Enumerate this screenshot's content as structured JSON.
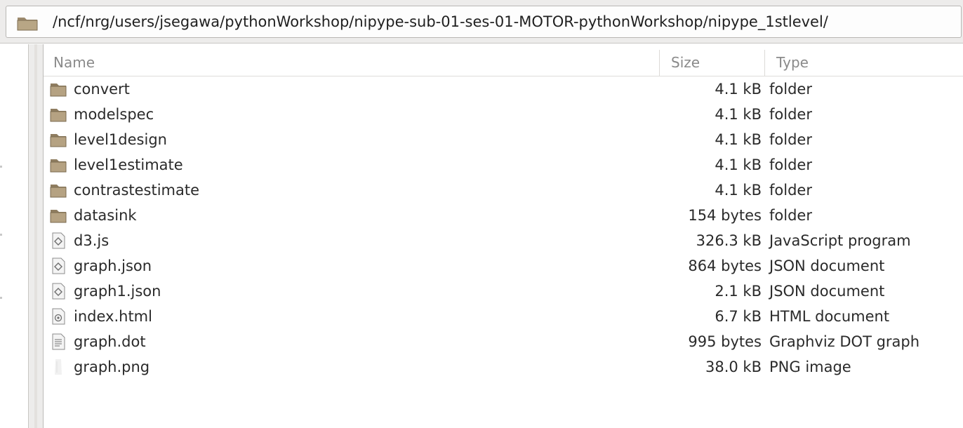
{
  "location": {
    "path": "/ncf/nrg/users/jsegawa/pythonWorkshop/nipype-sub-01-ses-01-MOTOR-pythonWorkshop/nipype_1stlevel/",
    "icon": "folder-icon"
  },
  "columns": {
    "name": "Name",
    "size": "Size",
    "type": "Type"
  },
  "files": [
    {
      "name": "convert",
      "size": "4.1 kB",
      "type": "folder",
      "icon": "folder-icon"
    },
    {
      "name": "modelspec",
      "size": "4.1 kB",
      "type": "folder",
      "icon": "folder-icon"
    },
    {
      "name": "level1design",
      "size": "4.1 kB",
      "type": "folder",
      "icon": "folder-icon"
    },
    {
      "name": "level1estimate",
      "size": "4.1 kB",
      "type": "folder",
      "icon": "folder-icon"
    },
    {
      "name": "contrastestimate",
      "size": "4.1 kB",
      "type": "folder",
      "icon": "folder-icon"
    },
    {
      "name": "datasink",
      "size": "154 bytes",
      "type": "folder",
      "icon": "folder-icon"
    },
    {
      "name": "d3.js",
      "size": "326.3 kB",
      "type": "JavaScript program",
      "icon": "script-file-icon"
    },
    {
      "name": "graph.json",
      "size": "864 bytes",
      "type": "JSON document",
      "icon": "script-file-icon"
    },
    {
      "name": "graph1.json",
      "size": "2.1 kB",
      "type": "JSON document",
      "icon": "script-file-icon"
    },
    {
      "name": "index.html",
      "size": "6.7 kB",
      "type": "HTML document",
      "icon": "html-file-icon"
    },
    {
      "name": "graph.dot",
      "size": "995 bytes",
      "type": "Graphviz DOT graph",
      "icon": "text-file-icon"
    },
    {
      "name": "graph.png",
      "size": "38.0 kB",
      "type": "PNG image",
      "icon": "image-file-icon"
    }
  ]
}
